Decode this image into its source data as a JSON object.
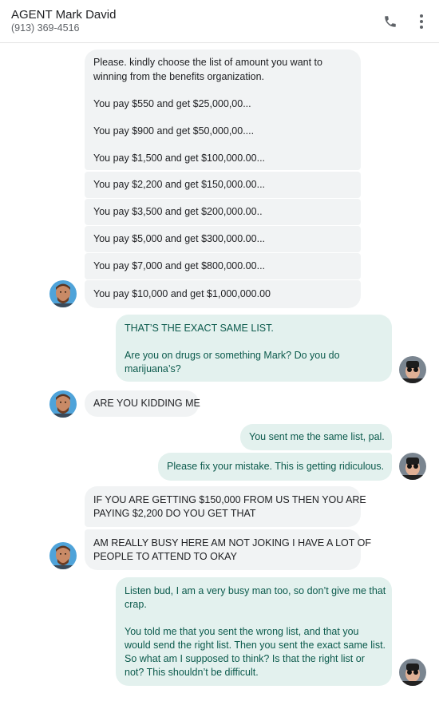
{
  "header": {
    "contact_name": "AGENT Mark David",
    "contact_phone": "(913) 369-4516",
    "call_icon": "phone-icon",
    "more_icon": "more-vert-icon"
  },
  "messages": [
    {
      "from": "Mark",
      "lines": [
        "Please. kindly choose the list of amount you want to",
        "winning from the benefits organization.",
        "You pay $550 and get $25,000,00...",
        "You pay $900 and get $50,000,00....",
        "You pay $1,500 and get $100,000.00..."
      ]
    },
    {
      "from": "Mark",
      "lines": [
        "You pay $2,200 and get $150,000.00..."
      ]
    },
    {
      "from": "Mark",
      "lines": [
        "You pay $3,500 and get $200,000.00.."
      ]
    },
    {
      "from": "Mark",
      "lines": [
        "You pay $5,000 and get $300,000.00..."
      ]
    },
    {
      "from": "Mark",
      "lines": [
        "You pay $7,000 and get $800,000.00..."
      ]
    },
    {
      "from": "Mark",
      "lines": [
        "You pay $10,000 and get $1,000,000.00"
      ]
    },
    {
      "from": "me",
      "lines": [
        "THAT’S THE EXACT SAME LIST.",
        "Are you on drugs or something Mark? Do you do",
        "marijuana’s?"
      ]
    },
    {
      "from": "Mark",
      "lines": [
        "ARE YOU KIDDING ME"
      ]
    },
    {
      "from": "me",
      "lines": [
        "You sent me the same list, pal."
      ]
    },
    {
      "from": "me",
      "lines": [
        "Please fix your mistake. This is getting ridiculous."
      ]
    },
    {
      "from": "Mark",
      "lines": [
        "IF YOU ARE GETTING $150,000 FROM US THEN YOU ARE",
        "PAYING $2,200  DO YOU GET THAT"
      ]
    },
    {
      "from": "Mark",
      "lines": [
        "AM REALLY BUSY HERE AM NOT JOKING I HAVE A LOT OF",
        "PEOPLE TO ATTEND TO OKAY"
      ]
    },
    {
      "from": "me",
      "lines": [
        "Listen bud, I am a very busy man too, so don’t give me that",
        "crap.",
        "You told me that you sent the wrong list, and that you",
        "would send the right list. Then you sent the exact same list.",
        "So what am I supposed to think? Is that the right list or",
        "not? This shouldn’t be difficult."
      ]
    }
  ],
  "colors": {
    "incoming_bubble": "#f1f3f4",
    "outgoing_bubble": "#e3f1ee",
    "outgoing_text": "#0b5a4c"
  }
}
